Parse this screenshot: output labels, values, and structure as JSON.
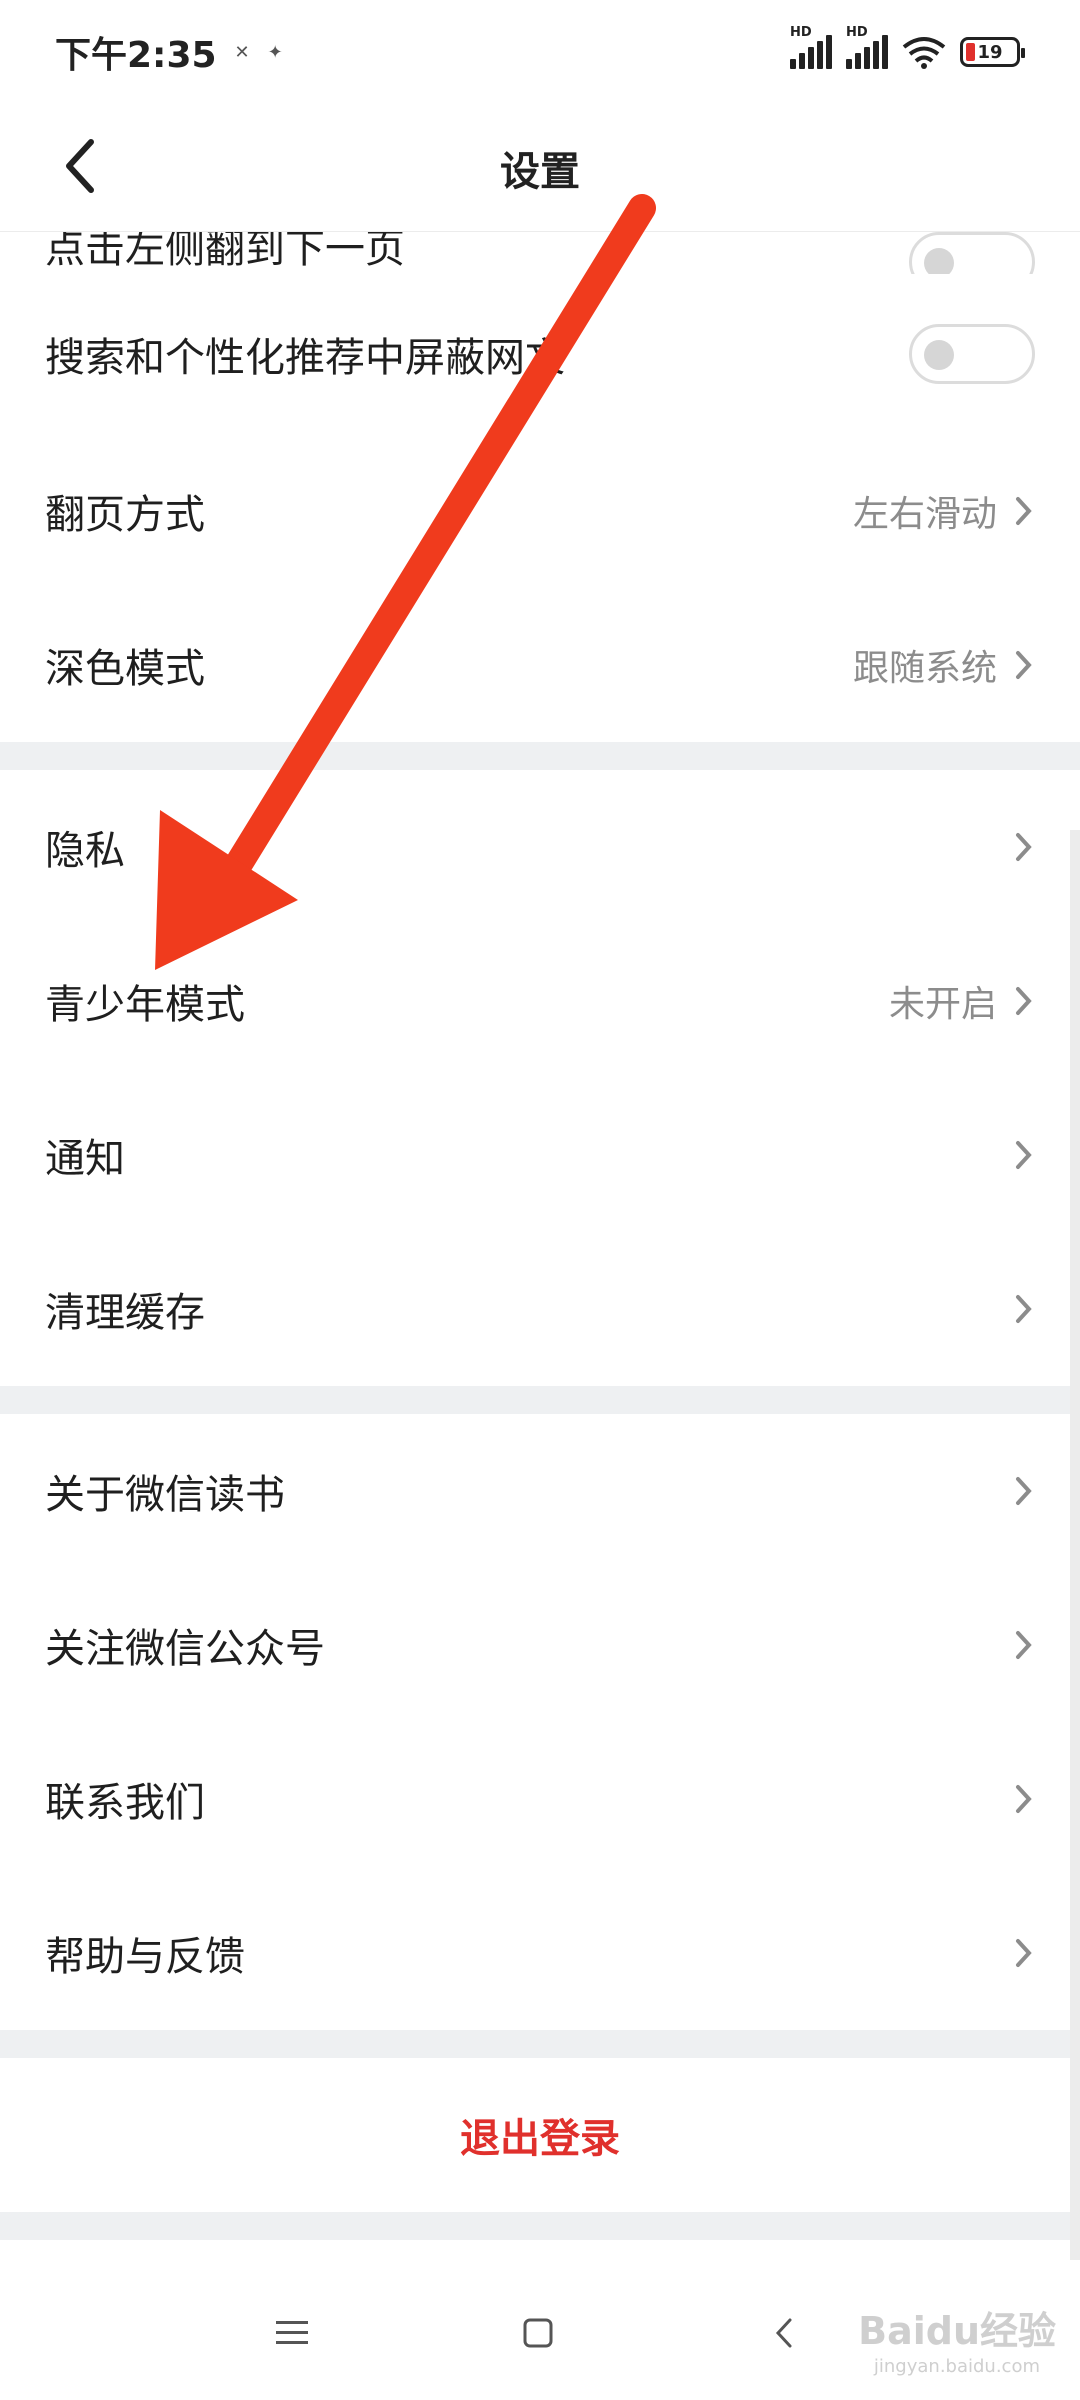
{
  "status_bar": {
    "time": "下午2:35",
    "signal_label_1": "HD",
    "signal_label_2": "HD",
    "battery": "19",
    "battery_level_percent": 19
  },
  "nav": {
    "title": "设置"
  },
  "group1": {
    "items": [
      {
        "label": "点击左侧翻到下一页"
      },
      {
        "label": "搜索和个性化推荐中屏蔽网文"
      },
      {
        "label": "翻页方式",
        "value": "左右滑动"
      },
      {
        "label": "深色模式",
        "value": "跟随系统"
      }
    ]
  },
  "group2": {
    "items": [
      {
        "label": "隐私"
      },
      {
        "label": "青少年模式",
        "value": "未开启"
      },
      {
        "label": "通知"
      },
      {
        "label": "清理缓存"
      }
    ]
  },
  "group3": {
    "items": [
      {
        "label": "关于微信读书"
      },
      {
        "label": "关注微信公众号"
      },
      {
        "label": "联系我们"
      },
      {
        "label": "帮助与反馈"
      }
    ]
  },
  "logout": {
    "label": "退出登录"
  },
  "watermark": {
    "text": "Baidu经验",
    "sub": "jingyan.baidu.com"
  },
  "colors": {
    "accent_red": "#e0302c",
    "arrow": "#f03b1d"
  }
}
